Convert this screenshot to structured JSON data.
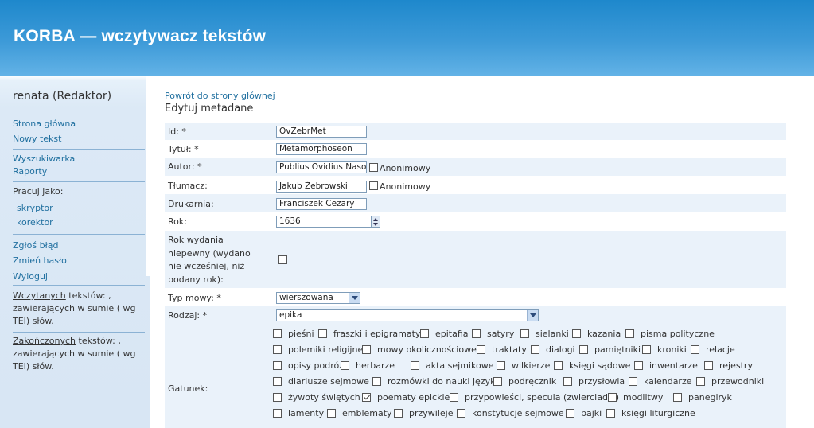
{
  "header": {
    "title": "KORBA — wczytywacz tekstów"
  },
  "sidebar": {
    "user": "renata (Redaktor)",
    "links_top": [
      "Strona główna",
      "Nowy tekst"
    ],
    "links_mid": [
      "Wyszukiwarka",
      "Raporty"
    ],
    "work_as_label": "Pracuj jako:",
    "work_as": [
      "skryptor",
      "korektor"
    ],
    "links_bottom": [
      "Zgłoś błąd",
      "Zmień hasło",
      "Wyloguj"
    ],
    "stats_loaded": {
      "link": "Wczytanych",
      "text1": " tekstów: ,",
      "text2": "zawierających w sumie ( wg",
      "text3": "TEI) słów."
    },
    "stats_finished": {
      "link": "Zakończonych",
      "text1": " tekstów: ,",
      "text2": "zawierających w sumie ( wg",
      "text3": "TEI) słów."
    }
  },
  "main": {
    "back_link": "Powrót do strony głównej",
    "title": "Edytuj metadane",
    "fields": {
      "id": {
        "label": "Id: *",
        "value": "OvŻebrMet"
      },
      "title": {
        "label": "Tytuł: *",
        "value": "Metamorphoseon"
      },
      "author": {
        "label": "Autor: *",
        "value": "Publius Ovidius Naso",
        "anon_label": "Anonimowy",
        "anon_checked": false
      },
      "translator": {
        "label": "Tłumacz:",
        "value": "Jakub Żebrowski",
        "anon_label": "Anonimowy",
        "anon_checked": false
      },
      "printer": {
        "label": "Drukarnia:",
        "value": "Franciszek Cezary"
      },
      "year": {
        "label": "Rok:",
        "value": "1636"
      },
      "uncertain_year": {
        "label_lines": [
          "Rok wydania",
          "niepewny (wydano",
          "nie wcześniej, niż",
          "podany rok):"
        ],
        "checked": false
      },
      "speech_type": {
        "label": "Typ mowy: *",
        "value": "wierszowana"
      },
      "kind": {
        "label": "Rodzaj: *",
        "value": "epika"
      },
      "genre": {
        "label": "Gatunek:",
        "rows": [
          [
            {
              "name": "pieśni",
              "checked": false
            },
            {
              "name": "fraszki i epigramaty",
              "checked": false
            },
            {
              "name": "epitafia",
              "checked": false
            },
            {
              "name": "satyry",
              "checked": false
            },
            {
              "name": "sielanki",
              "checked": false
            },
            {
              "name": "kazania",
              "checked": false
            },
            {
              "name": "pisma polityczne",
              "checked": false
            }
          ],
          [
            {
              "name": "polemiki religijne",
              "checked": false
            },
            {
              "name": "mowy okolicznościowe",
              "checked": false
            },
            {
              "name": "traktaty",
              "checked": false
            },
            {
              "name": "dialogi",
              "checked": false
            },
            {
              "name": "pamiętniki",
              "checked": false
            },
            {
              "name": "kroniki",
              "checked": false
            },
            {
              "name": "relacje",
              "checked": false
            }
          ],
          [
            {
              "name": "opisy podróży",
              "checked": false
            },
            {
              "name": "herbarze",
              "checked": false
            },
            {
              "name": "akta sejmikowe",
              "checked": false
            },
            {
              "name": "wilkierze",
              "checked": false
            },
            {
              "name": "księgi sądowe",
              "checked": false
            },
            {
              "name": "inwentarze",
              "checked": false
            },
            {
              "name": "rejestry",
              "checked": false
            }
          ],
          [
            {
              "name": "diariusze sejmowe",
              "checked": false
            },
            {
              "name": "rozmówki do nauki języka",
              "checked": false
            },
            {
              "name": "podręcznik",
              "checked": false
            },
            {
              "name": "przysłowia",
              "checked": false
            },
            {
              "name": "kalendarze",
              "checked": false
            },
            {
              "name": "przewodniki",
              "checked": false
            }
          ],
          [
            {
              "name": "żywoty świętych",
              "checked": false
            },
            {
              "name": "poematy epickie",
              "checked": true
            },
            {
              "name": "przypowieści, specula (zwierciadła)",
              "checked": false
            },
            {
              "name": "modlitwy",
              "checked": false
            },
            {
              "name": "panegiryk",
              "checked": false
            }
          ],
          [
            {
              "name": "lamenty",
              "checked": false
            },
            {
              "name": "emblematy",
              "checked": false
            },
            {
              "name": "przywileje",
              "checked": false
            },
            {
              "name": "konstytucje sejmowe",
              "checked": false
            },
            {
              "name": "bajki",
              "checked": false
            },
            {
              "name": "księgi liturgiczne",
              "checked": false
            }
          ]
        ]
      }
    }
  },
  "colors": {
    "header": "#3d9ad8",
    "link": "#1f6f9f",
    "row_alt": "#eaf2fa",
    "sidebar": "#dce9f6"
  }
}
